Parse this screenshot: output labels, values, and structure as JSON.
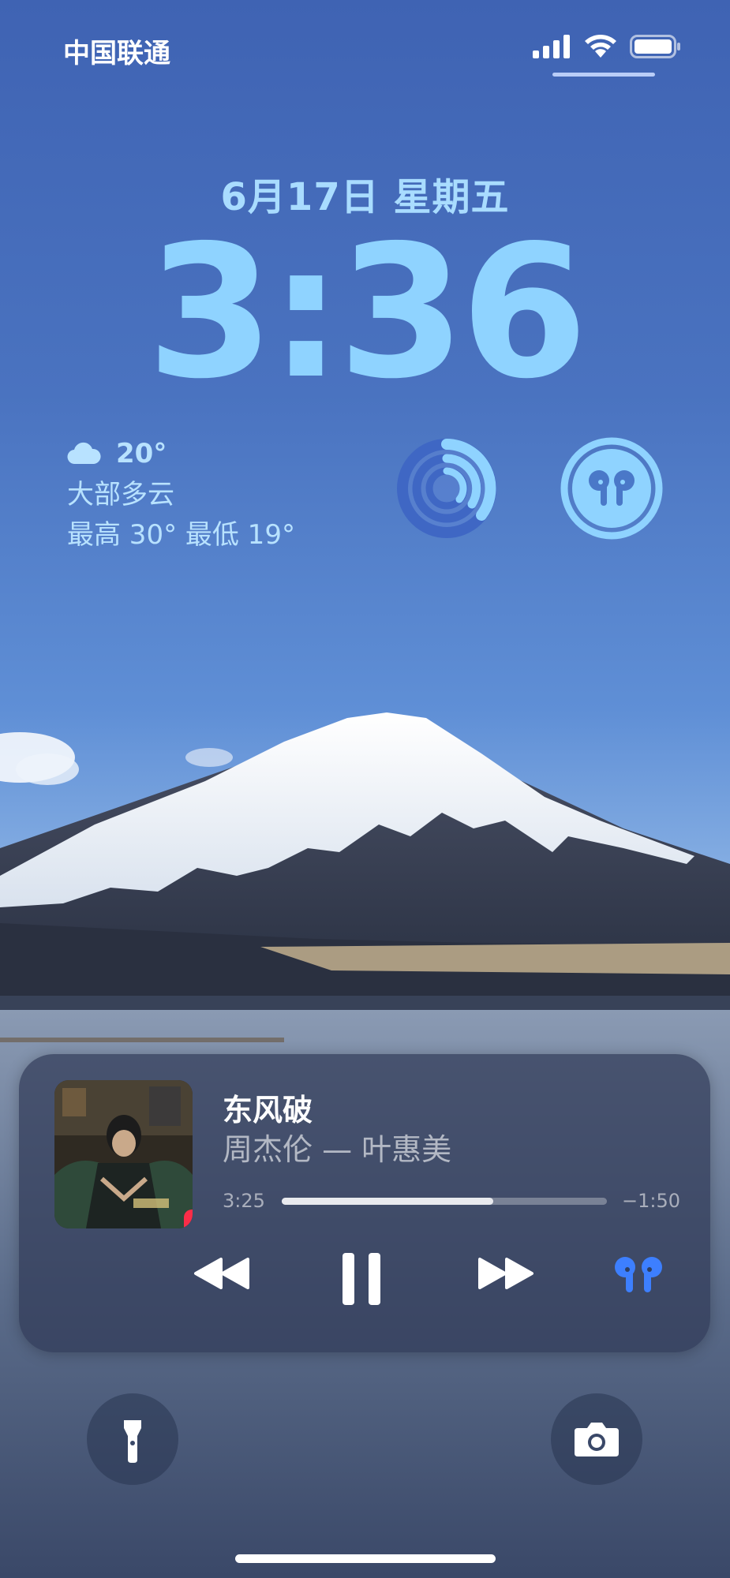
{
  "status_bar": {
    "carrier": "中国联通",
    "icons": [
      "cellular-signal-icon",
      "wifi-icon",
      "battery-icon"
    ]
  },
  "lock_screen": {
    "date": "6月17日 星期五",
    "time": "3:36"
  },
  "weather_widget": {
    "icon": "cloud-icon",
    "temperature": "20°",
    "condition": "大部多云",
    "high_low": "最高 30° 最低 19°"
  },
  "widgets": {
    "activity_icon": "activity-rings-icon",
    "airpods_icon": "airpods-battery-icon"
  },
  "now_playing": {
    "song": "东风破",
    "artist": "周杰伦 — 叶惠美",
    "elapsed": "3:25",
    "remaining": "−1:50",
    "progress": 0.65,
    "album_badge": "apple-music-icon",
    "controls": {
      "rewind": "rewind-icon",
      "pause": "pause-icon",
      "forward": "fast-forward-icon",
      "output": "airpods-icon"
    }
  },
  "bottom_actions": {
    "left": "flashlight-icon",
    "right": "camera-icon"
  },
  "colors": {
    "clock": "#8fd3ff",
    "date": "#a9dcff",
    "accent_blue": "#3d7fff",
    "music_red": "#fa2d48"
  }
}
